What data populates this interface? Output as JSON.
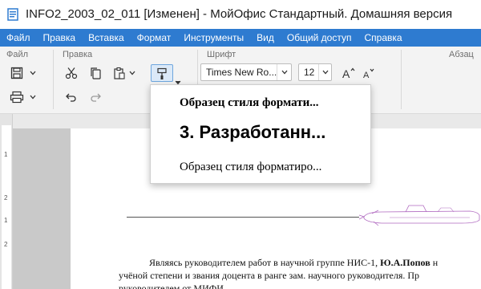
{
  "window": {
    "title": "INFO2_2003_02_011 [Изменен] - МойОфис Стандартный. Домашняя версия"
  },
  "menu": {
    "items": [
      "Файл",
      "Правка",
      "Вставка",
      "Формат",
      "Инструменты",
      "Вид",
      "Общий доступ",
      "Справка"
    ]
  },
  "ribbon": {
    "groups": {
      "file": "Файл",
      "edit": "Правка",
      "font": "Шрифт",
      "paragraph": "Абзац"
    },
    "font_name": "Times New Ro...",
    "font_size": "12",
    "icons": {
      "save": "save-icon",
      "print": "print-icon",
      "cut": "cut-icon",
      "copy": "copy-icon",
      "paste": "paste-icon",
      "format_painter": "format-painter-icon",
      "undo": "undo-icon",
      "redo": "redo-icon",
      "grow_font": "grow-font-icon",
      "shrink_font": "shrink-font-icon"
    }
  },
  "style_popup": {
    "items": [
      "Образец стиля формати...",
      "3. Разработанн...",
      "Образец стиля форматиро..."
    ]
  },
  "document": {
    "ruler_numbers": [
      "1",
      "2",
      "1",
      "2"
    ],
    "line1_start": "Являясь руководителем работ в научной группе НИС-1, ",
    "line1_bold": "Ю.А.Попов",
    "line1_end": " н",
    "line2": "учёной степени и звания доцента в ранге зам. научного руководителя. Пр",
    "line3": "руководителем от МИФИ."
  },
  "colors": {
    "accent": "#2e7bd0",
    "menubar_text": "#ffffff",
    "selected_button_bg": "#dbe9f8"
  }
}
